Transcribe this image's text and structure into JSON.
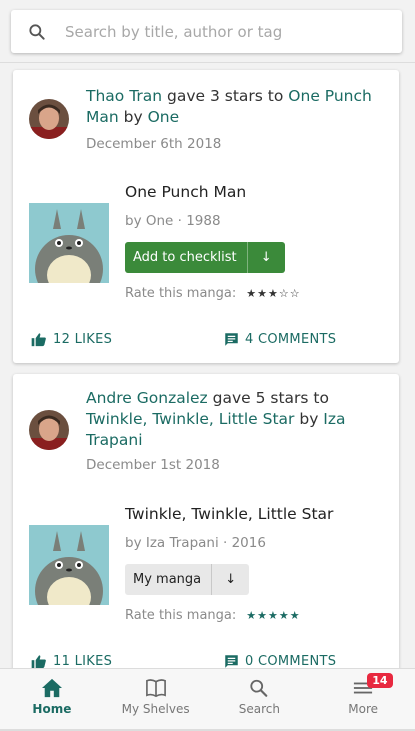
{
  "search": {
    "placeholder": "Search by title, author or tag"
  },
  "feed": [
    {
      "user": "Thao Tran",
      "action_text": " gave 3 stars to ",
      "manga_link": "One Punch Man",
      "by_text": " by ",
      "author_link": "One",
      "date": "December 6th 2018",
      "manga_title": "One Punch Man",
      "manga_meta": "by One · 1988",
      "button_label": "Add to checklist",
      "button_style": "green",
      "rate_label": "Rate this manga:",
      "rating": 3,
      "star_color": "#333333",
      "likes": "12 LIKES",
      "comments": "4 COMMENTS"
    },
    {
      "user": "Andre Gonzalez",
      "action_text": " gave 5 stars to ",
      "manga_link": "Twinkle, Twinkle, Little Star",
      "by_text": " by ",
      "author_link": "Iza Trapani",
      "date": "December 1st 2018",
      "manga_title": "Twinkle, Twinkle, Little Star",
      "manga_meta": "by Iza Trapani · 2016",
      "button_label": "My manga",
      "button_style": "grey",
      "rate_label": "Rate this manga:",
      "rating": 5,
      "star_color": "#1b6b63",
      "likes": "11 LIKES",
      "comments": "0 COMMENTS"
    }
  ],
  "nav": {
    "items": [
      {
        "label": "Home",
        "icon": "home-icon",
        "active": true
      },
      {
        "label": "My Shelves",
        "icon": "book-icon",
        "active": false
      },
      {
        "label": "Search",
        "icon": "search-icon",
        "active": false
      },
      {
        "label": "More",
        "icon": "menu-icon",
        "active": false,
        "badge": "14"
      }
    ]
  },
  "colors": {
    "accent": "#1b6b63",
    "button_green": "#3b8a3a",
    "badge": "#e8283f"
  }
}
